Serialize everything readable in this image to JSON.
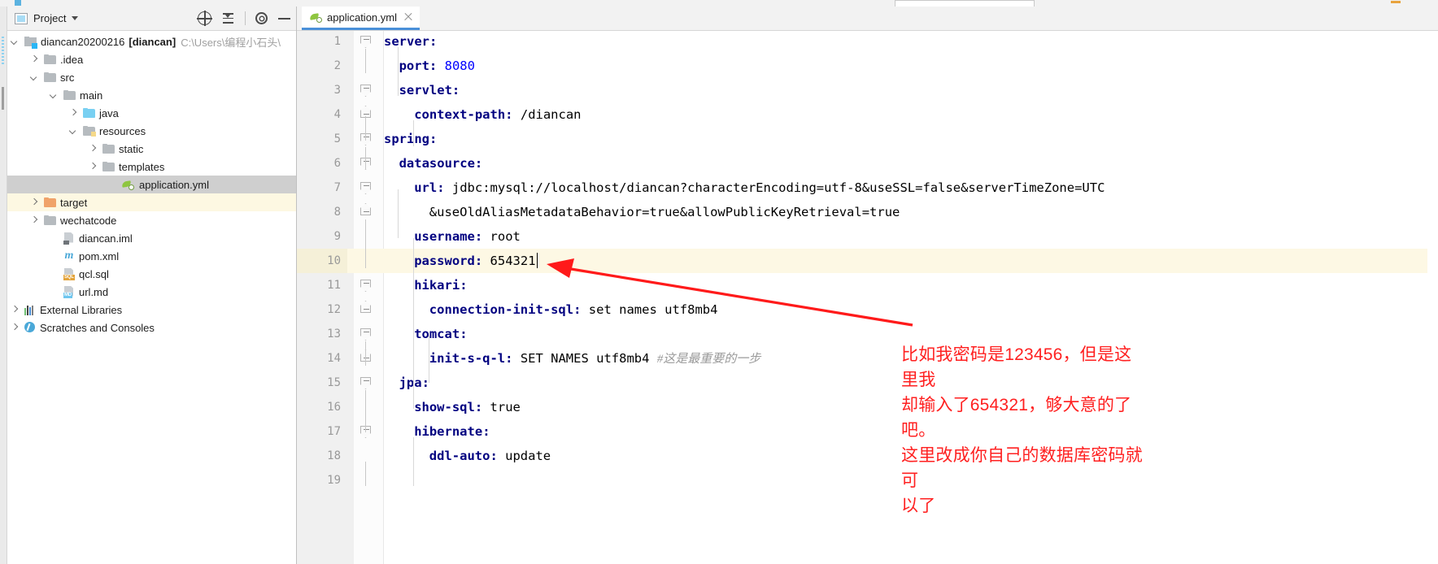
{
  "window": {
    "panel_title": "Project"
  },
  "toolbar": {
    "locate_icon": "crosshair-icon",
    "collapse_icon": "collapse-all-icon",
    "settings_icon": "gear-icon",
    "hide_icon": "minimize-icon"
  },
  "tree": [
    {
      "label": "diancan20200216",
      "bold_suffix": "[diancan]",
      "path": "C:\\Users\\编程小石头\\",
      "type": "project",
      "arrow": "down",
      "indent": 0
    },
    {
      "label": ".idea",
      "type": "folder",
      "arrow": "right",
      "indent": 1
    },
    {
      "label": "src",
      "type": "folder",
      "arrow": "down",
      "indent": 1
    },
    {
      "label": "main",
      "type": "folder",
      "arrow": "down",
      "indent": 2
    },
    {
      "label": "java",
      "type": "folder-blue",
      "arrow": "right",
      "indent": 3
    },
    {
      "label": "resources",
      "type": "folder-resources",
      "arrow": "down",
      "indent": 3
    },
    {
      "label": "static",
      "type": "folder",
      "arrow": "right",
      "indent": 4
    },
    {
      "label": "templates",
      "type": "folder",
      "arrow": "right",
      "indent": 4
    },
    {
      "label": "application.yml",
      "type": "yml",
      "arrow": "none",
      "indent": 5,
      "state": "selected"
    },
    {
      "label": "target",
      "type": "folder-orange",
      "arrow": "right",
      "indent": 1,
      "state": "highlight"
    },
    {
      "label": "wechatcode",
      "type": "folder",
      "arrow": "right",
      "indent": 1
    },
    {
      "label": "diancan.iml",
      "type": "iml",
      "arrow": "none",
      "indent": 2
    },
    {
      "label": "pom.xml",
      "type": "maven",
      "arrow": "none",
      "indent": 2
    },
    {
      "label": "qcl.sql",
      "type": "sql",
      "arrow": "none",
      "indent": 2
    },
    {
      "label": "url.md",
      "type": "md",
      "arrow": "none",
      "indent": 2
    },
    {
      "label": "External Libraries",
      "type": "libraries",
      "arrow": "right",
      "indent": 0
    },
    {
      "label": "Scratches and Consoles",
      "type": "scratches",
      "arrow": "right",
      "indent": 0
    }
  ],
  "editor": {
    "tab_label": "application.yml",
    "tab_icon": "yaml-file-icon",
    "close_icon": "close-icon",
    "lines": [
      {
        "n": "1",
        "indent": 0,
        "key": "server",
        "sep": ":",
        "value": "",
        "value_type": "none",
        "fold": "shield"
      },
      {
        "n": "2",
        "indent": 1,
        "key": "port",
        "sep": ":",
        "value": "8080",
        "value_type": "num",
        "fold": "none"
      },
      {
        "n": "3",
        "indent": 1,
        "key": "servlet",
        "sep": ":",
        "value": "",
        "value_type": "none",
        "fold": "shield"
      },
      {
        "n": "4",
        "indent": 2,
        "key": "context-path",
        "sep": ":",
        "value": "/diancan",
        "value_type": "plain",
        "fold": "bot"
      },
      {
        "n": "5",
        "indent": 0,
        "key": "spring",
        "sep": ":",
        "value": "",
        "value_type": "none",
        "fold": "shield"
      },
      {
        "n": "6",
        "indent": 1,
        "key": "datasource",
        "sep": ":",
        "value": "",
        "value_type": "none",
        "fold": "shield"
      },
      {
        "n": "7",
        "indent": 2,
        "key": "url",
        "sep": ":",
        "value": "jdbc:mysql://localhost/diancan?characterEncoding=utf-8&useSSL=false&serverTimeZone=UTC",
        "value_type": "plain",
        "fold": "shield"
      },
      {
        "n": "8",
        "indent": 3,
        "key": "",
        "sep": "",
        "value": "&useOldAliasMetadataBehavior=true&allowPublicKeyRetrieval=true",
        "value_type": "plain",
        "fold": "bot"
      },
      {
        "n": "9",
        "indent": 2,
        "key": "username",
        "sep": ":",
        "value": "root",
        "value_type": "plain",
        "fold": "none"
      },
      {
        "n": "10",
        "indent": 2,
        "key": "password",
        "sep": ":",
        "value": "654321",
        "value_type": "plain",
        "fold": "none",
        "current": true,
        "caret": true
      },
      {
        "n": "11",
        "indent": 2,
        "key": "hikari",
        "sep": ":",
        "value": "",
        "value_type": "none",
        "fold": "shield"
      },
      {
        "n": "12",
        "indent": 3,
        "key": "connection-init-sql",
        "sep": ":",
        "value": "set names utf8mb4",
        "value_type": "plain",
        "fold": "bot"
      },
      {
        "n": "13",
        "indent": 2,
        "key": "tomcat",
        "sep": ":",
        "value": "",
        "value_type": "none",
        "fold": "shield"
      },
      {
        "n": "14",
        "indent": 3,
        "key": "init-s-q-l",
        "sep": ":",
        "value": "SET NAMES utf8mb4",
        "value_type": "plain",
        "comment": "#这是最重要的一步",
        "fold": "bot"
      },
      {
        "n": "15",
        "indent": 1,
        "key": "jpa",
        "sep": ":",
        "value": "",
        "value_type": "none",
        "fold": "shield"
      },
      {
        "n": "16",
        "indent": 2,
        "key": "show-sql",
        "sep": ":",
        "value": "true",
        "value_type": "plain",
        "fold": "none"
      },
      {
        "n": "17",
        "indent": 2,
        "key": "hibernate",
        "sep": ":",
        "value": "",
        "value_type": "none",
        "fold": "shield"
      },
      {
        "n": "18",
        "indent": 3,
        "key": "ddl-auto",
        "sep": ":",
        "value": "update",
        "value_type": "plain",
        "fold": "none"
      },
      {
        "n": "19",
        "indent": 0,
        "key": "",
        "sep": "",
        "value": "",
        "value_type": "none",
        "fold": "none"
      }
    ]
  },
  "annotation": {
    "color": "#ff2020",
    "line1": "比如我密码是123456，但是这里我",
    "line2": "却输入了654321，够大意的了吧。",
    "line3": "这里改成你自己的数据库密码就可",
    "line4": "以了"
  }
}
